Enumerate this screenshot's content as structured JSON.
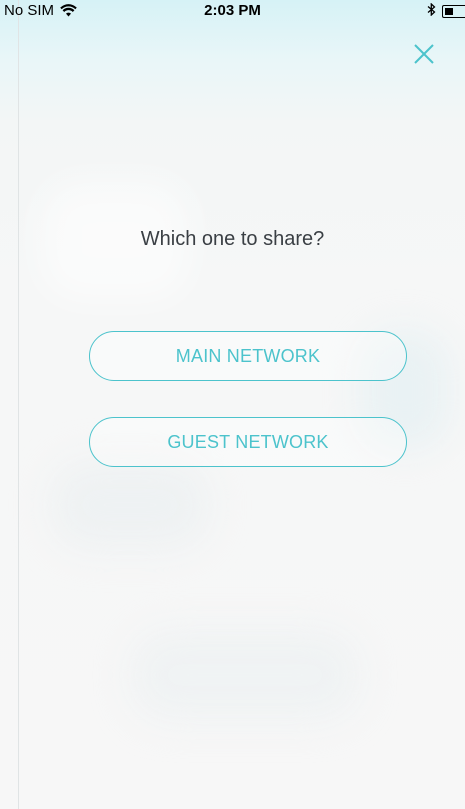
{
  "status_bar": {
    "carrier": "No SIM",
    "time": "2:03 PM"
  },
  "icons": {
    "wifi": "wifi-icon",
    "bluetooth": "bluetooth-icon",
    "battery": "battery-icon",
    "close": "close-icon"
  },
  "colors": {
    "accent": "#4cc3cc",
    "title_text": "#3a3f44"
  },
  "dialog": {
    "title": "Which one to share?",
    "options": [
      {
        "label": "MAIN NETWORK"
      },
      {
        "label": "GUEST NETWORK"
      }
    ]
  }
}
